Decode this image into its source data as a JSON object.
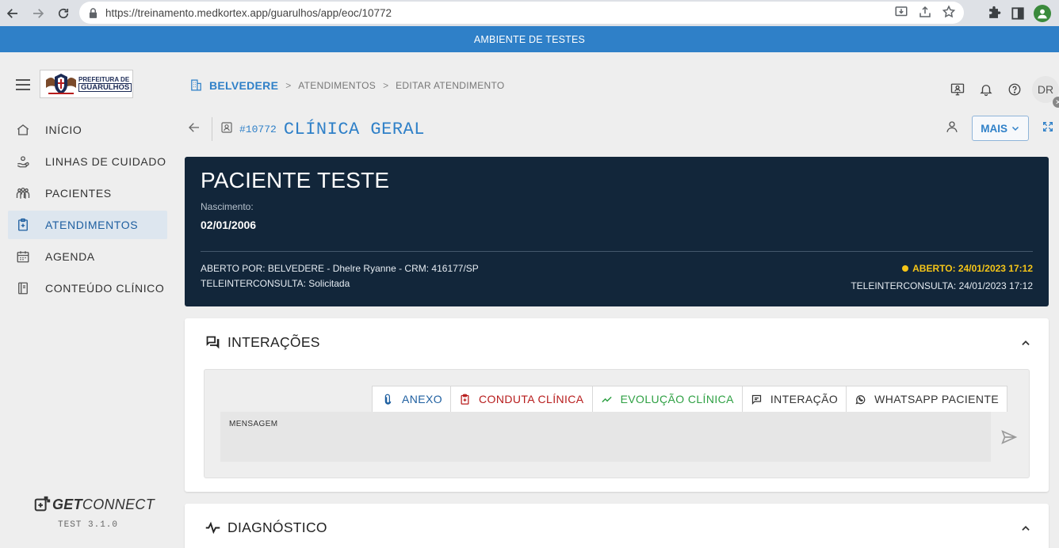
{
  "browser": {
    "url": "https://treinamento.medkortex.app/guarulhos/app/eoc/10772"
  },
  "banner": {
    "text": "AMBIENTE DE TESTES"
  },
  "sidebar": {
    "logo": {
      "line1": "PREFEITURA DE",
      "line2": "GUARULHOS"
    },
    "items": [
      {
        "label": "INÍCIO",
        "icon": "home-icon"
      },
      {
        "label": "LINHAS DE CUIDADO",
        "icon": "care-hand-icon"
      },
      {
        "label": "PACIENTES",
        "icon": "people-icon"
      },
      {
        "label": "ATENDIMENTOS",
        "icon": "clipboard-icon",
        "active": true
      },
      {
        "label": "AGENDA",
        "icon": "calendar-icon"
      },
      {
        "label": "CONTEÚDO CLÍNICO",
        "icon": "book-icon"
      }
    ],
    "brand": {
      "bold": "GET",
      "light": "CONNECT"
    },
    "version": "TEST 3.1.0"
  },
  "breadcrumb": {
    "root": "BELVEDERE",
    "items": [
      "ATENDIMENTOS",
      "EDITAR ATENDIMENTO"
    ],
    "separator": ">"
  },
  "user": {
    "initials": "DR"
  },
  "encounter": {
    "id": "#10772",
    "title": "CLÍNICA GERAL",
    "more_label": "MAIS"
  },
  "patient": {
    "name": "PACIENTE TESTE",
    "birth_label": "Nascimento:",
    "birth_date": "02/01/2006",
    "opened_by": "ABERTO POR: BELVEDERE - Dhelre Ryanne  -  CRM: 416177/SP",
    "tele_status": "TELEINTERCONSULTA: Solicitada",
    "status": "ABERTO: 24/01/2023 17:12",
    "status_color": "#f5c518",
    "tele_time": "TELEINTERCONSULTA:  24/01/2023 17:12"
  },
  "interactions": {
    "title": "INTERAÇÕES",
    "tabs": [
      {
        "label": "ANEXO",
        "icon": "paperclip-icon",
        "color": "#1e5fa0"
      },
      {
        "label": "CONDUTA CLÍNICA",
        "icon": "clipboard-icon",
        "color": "#b71c1c"
      },
      {
        "label": "EVOLUÇÃO CLÍNICA",
        "icon": "trend-icon",
        "color": "#2ea043"
      },
      {
        "label": "INTERAÇÃO",
        "icon": "chat-icon",
        "color": "#333333"
      },
      {
        "label": "WHATSAPP PACIENTE",
        "icon": "whatsapp-icon",
        "color": "#333333"
      }
    ],
    "message_label": "MENSAGEM"
  },
  "diagnostics": {
    "title": "DIAGNÓSTICO"
  }
}
